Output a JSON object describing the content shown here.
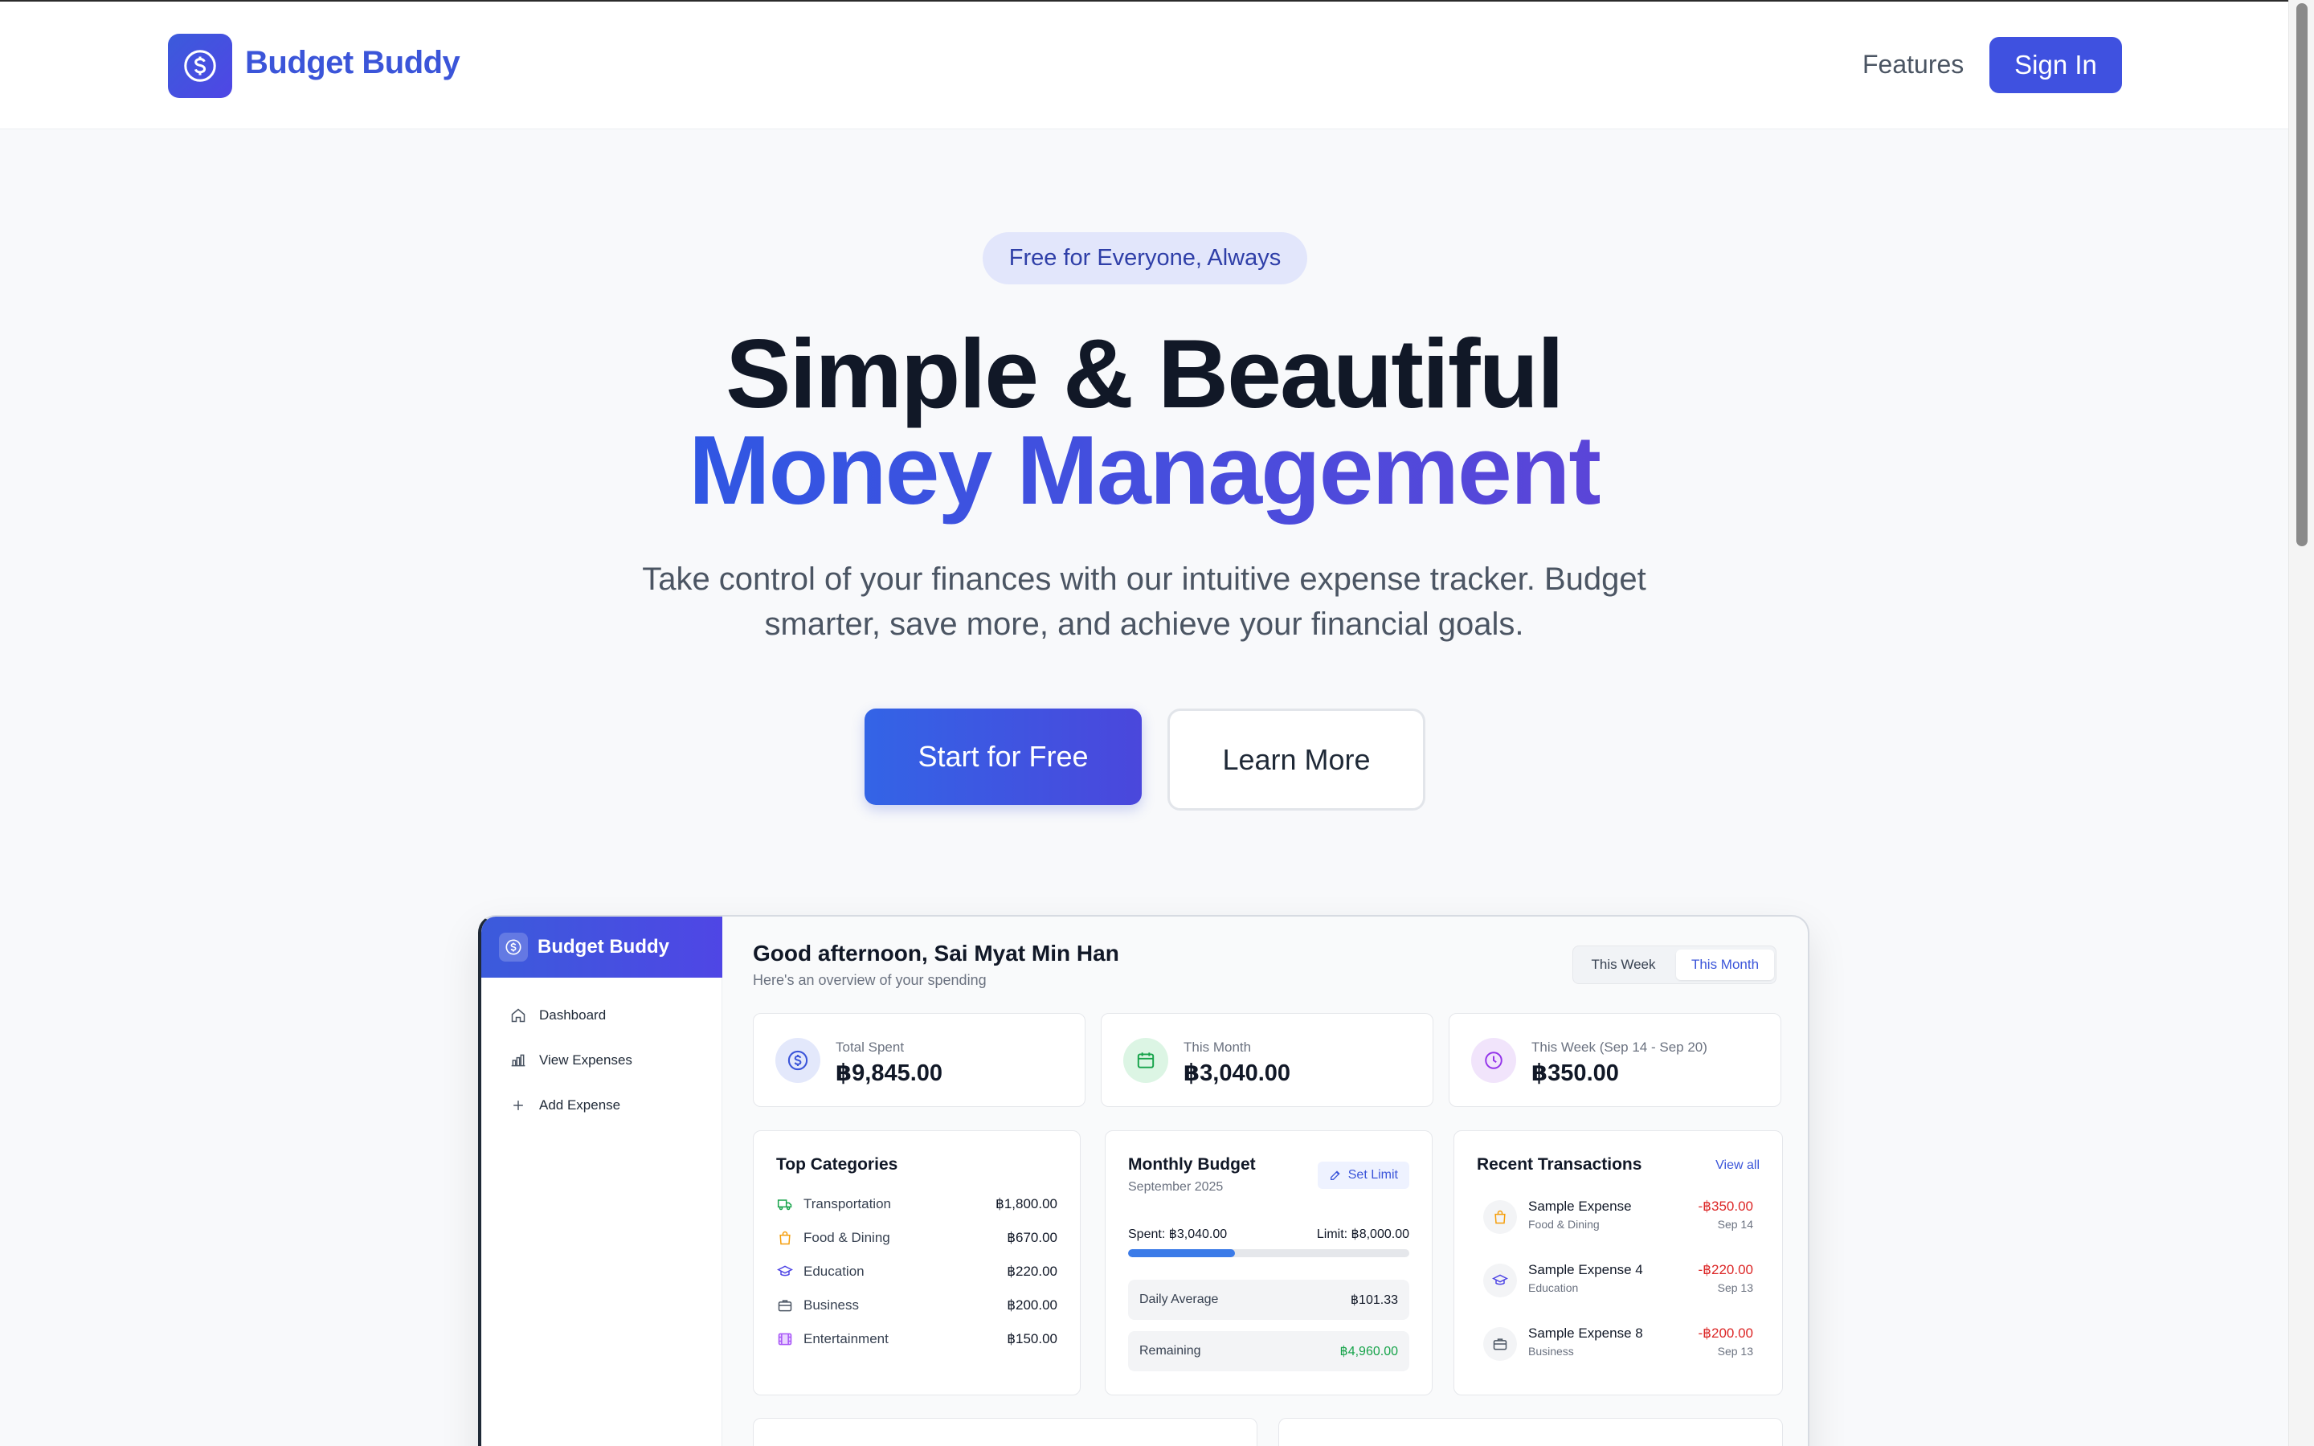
{
  "header": {
    "brand": "Budget Buddy",
    "nav_features": "Features",
    "sign_in": "Sign In"
  },
  "hero": {
    "badge": "Free for Everyone, Always",
    "title_line1": "Simple & Beautiful",
    "title_line2": "Money Management",
    "subtitle_line1": "Take control of your finances with our intuitive expense tracker. Budget",
    "subtitle_line2": "smarter, save more, and achieve your financial goals.",
    "cta_primary": "Start for Free",
    "cta_secondary": "Learn More"
  },
  "dashboard": {
    "brand": "Budget Buddy",
    "sidebar": [
      {
        "label": "Dashboard",
        "icon": "home-icon"
      },
      {
        "label": "View Expenses",
        "icon": "bar-chart-icon"
      },
      {
        "label": "Add Expense",
        "icon": "plus-icon"
      }
    ],
    "greeting": "Good afternoon, Sai Myat Min Han",
    "greeting_sub": "Here's an overview of your spending",
    "toggle": {
      "week": "This Week",
      "month": "This Month",
      "selected": "This Month"
    },
    "stats": [
      {
        "label": "Total Spent",
        "value": "฿9,845.00",
        "icon": "dollar-icon",
        "color": "#3b55d9"
      },
      {
        "label": "This Month",
        "value": "฿3,040.00",
        "icon": "calendar-icon",
        "color": "#16a34a"
      },
      {
        "label": "This Week (Sep 14 - Sep 20)",
        "value": "฿350.00",
        "icon": "clock-icon",
        "color": "#9333ea"
      }
    ],
    "top_categories": {
      "title": "Top Categories",
      "items": [
        {
          "name": "Transportation",
          "amount": "฿1,800.00",
          "icon": "truck-icon",
          "color": "#16a34a"
        },
        {
          "name": "Food & Dining",
          "amount": "฿670.00",
          "icon": "shopping-bag-icon",
          "color": "#f59e0b"
        },
        {
          "name": "Education",
          "amount": "฿220.00",
          "icon": "graduation-cap-icon",
          "color": "#4f46e5"
        },
        {
          "name": "Business",
          "amount": "฿200.00",
          "icon": "briefcase-icon",
          "color": "#4b5563"
        },
        {
          "name": "Entertainment",
          "amount": "฿150.00",
          "icon": "film-icon",
          "color": "#a855f7"
        }
      ]
    },
    "monthly_budget": {
      "title": "Monthly Budget",
      "period": "September 2025",
      "set_limit": "Set Limit",
      "spent": "Spent: ฿3,040.00",
      "limit": "Limit: ฿8,000.00",
      "progress": 0.38,
      "daily_average_label": "Daily Average",
      "daily_average": "฿101.33",
      "remaining_label": "Remaining",
      "remaining": "฿4,960.00"
    },
    "recent": {
      "title": "Recent Transactions",
      "view_all": "View all",
      "items": [
        {
          "name": "Sample Expense",
          "category": "Food & Dining",
          "amount": "-฿350.00",
          "date": "Sep 14",
          "icon": "shopping-bag-icon",
          "color": "#f59e0b"
        },
        {
          "name": "Sample Expense 4",
          "category": "Education",
          "amount": "-฿220.00",
          "date": "Sep 13",
          "icon": "graduation-cap-icon",
          "color": "#4f46e5"
        },
        {
          "name": "Sample Expense 8",
          "category": "Business",
          "amount": "-฿200.00",
          "date": "Sep 13",
          "icon": "briefcase-icon",
          "color": "#4b5563"
        }
      ]
    }
  },
  "colors": {
    "primary": "#3f51e0",
    "accent_gradient_start": "#3057e3",
    "accent_gradient_end": "#5b45d8"
  }
}
